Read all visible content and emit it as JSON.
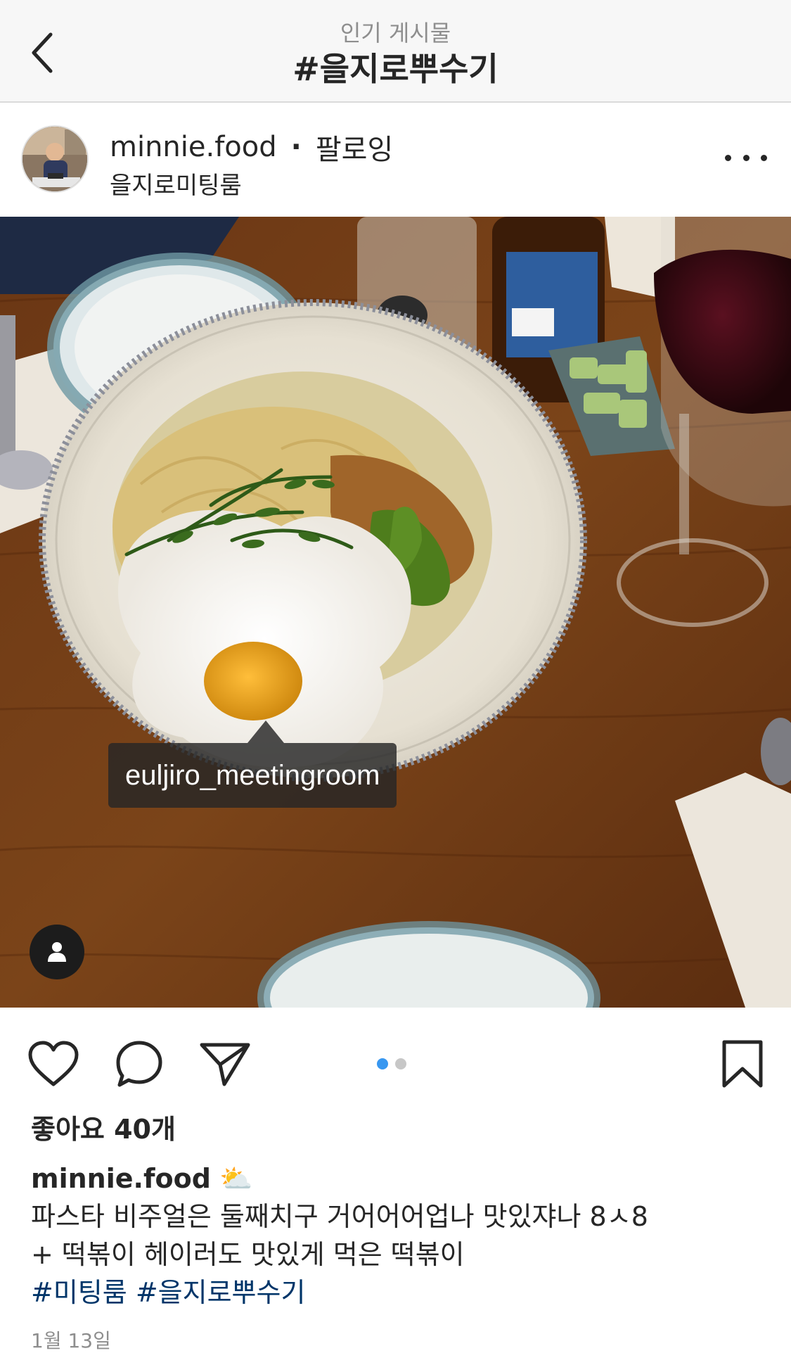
{
  "header": {
    "subtitle": "인기 게시물",
    "title": "#을지로뿌수기"
  },
  "post": {
    "username": "minnie.food",
    "separator": "·",
    "follow_label": "팔로잉",
    "location": "을지로미팅룸",
    "photo_tag": "euljiro_meetingroom",
    "carousel": {
      "count": 2,
      "active_index": 0,
      "active_color": "#3897f0",
      "inactive_color": "#c7c7c7"
    }
  },
  "likes": "좋아요 40개",
  "caption": {
    "username": "minnie.food",
    "emoji": "⛅",
    "line1": "파스타 비주얼은 둘째치구 거어어어업나 맛있쟈나 8ㅅ8",
    "line2": "+ 떡볶이 헤이러도 맛있게 먹은 떡볶이",
    "hashtag1": "#미팅룸",
    "hashtag2": "#을지로뿌수기"
  },
  "date": "1월 13일",
  "icons": {
    "back": "chevron-left-icon",
    "more": "more-horizontal-icon",
    "like": "heart-icon",
    "comment": "comment-icon",
    "share": "paper-plane-icon",
    "save": "bookmark-icon",
    "user_tag": "user-tag-icon"
  }
}
